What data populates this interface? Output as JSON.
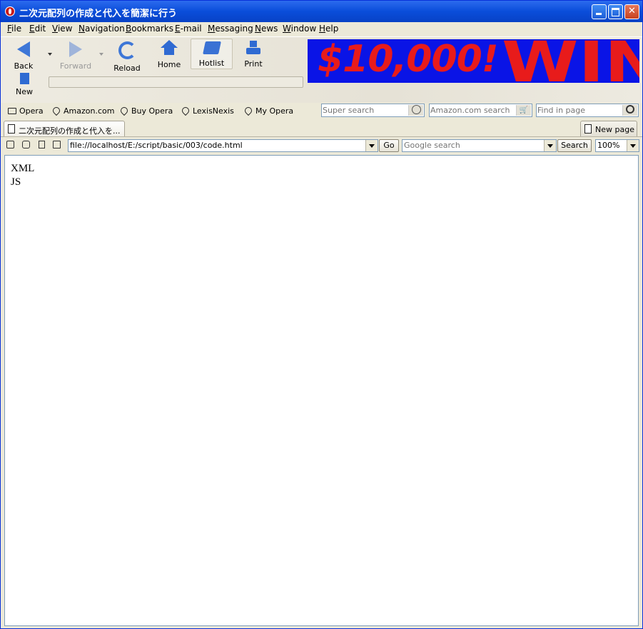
{
  "window": {
    "title": "二次元配列の作成と代入を簡潔に行う"
  },
  "menu": [
    "File",
    "Edit",
    "View",
    "Navigation",
    "Bookmarks",
    "E-mail",
    "Messaging",
    "News",
    "Window",
    "Help"
  ],
  "toolbar": {
    "back": "Back",
    "forward": "Forward",
    "reload": "Reload",
    "home": "Home",
    "hotlist": "Hotlist",
    "print": "Print",
    "new": "New"
  },
  "banner": {
    "amount": "$10,000!",
    "win": "WIN"
  },
  "personal_bar": [
    "Opera",
    "Amazon.com",
    "Buy Opera",
    "LexisNexis",
    "My Opera"
  ],
  "search": {
    "super_placeholder": "Super search",
    "amazon_placeholder": "Amazon.com search",
    "find_placeholder": "Find in page"
  },
  "tabs": {
    "active": "二次元配列の作成と代入を...",
    "new_page": "New page"
  },
  "address": {
    "url": "file://localhost/E:/script/basic/003/code.html",
    "go": "Go",
    "google_placeholder": "Google search",
    "search_button": "Search",
    "zoom": "100%"
  },
  "content": {
    "lines": [
      "XML",
      "JS"
    ]
  },
  "colors": {
    "title_bar": "#0A4DDA",
    "banner_bg": "#0A14E6",
    "banner_text": "#E81B1B"
  }
}
